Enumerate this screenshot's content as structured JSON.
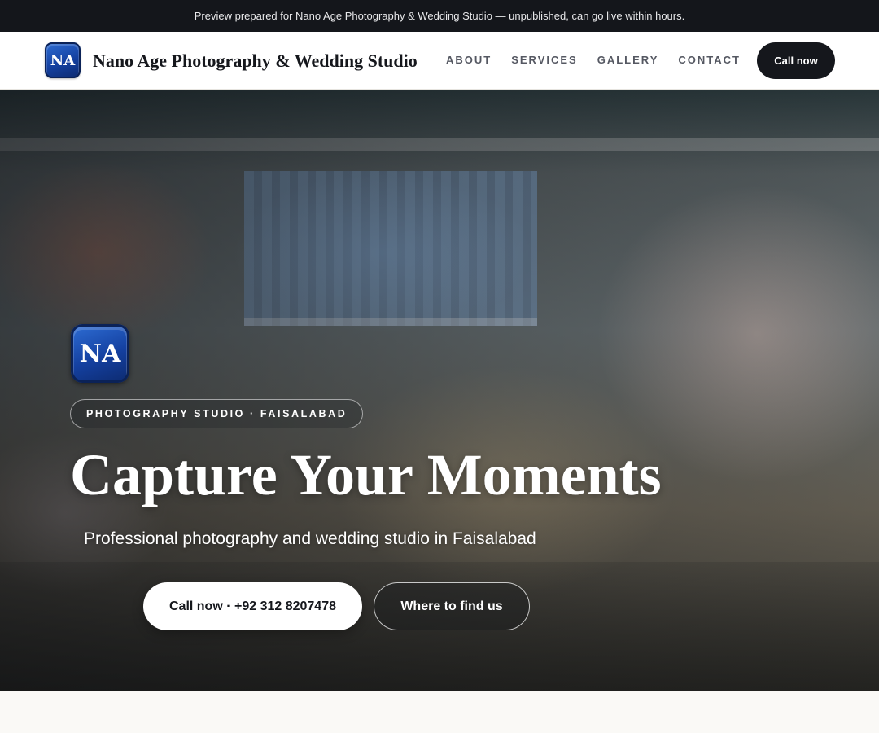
{
  "preview_bar": {
    "text": "Preview prepared for Nano Age Photography & Wedding Studio — unpublished, can go live within hours."
  },
  "nav": {
    "logo_text": "NA",
    "brand_name": "Nano Age Photography & Wedding Studio",
    "links": [
      {
        "label": "ABOUT"
      },
      {
        "label": "SERVICES"
      },
      {
        "label": "GALLERY"
      },
      {
        "label": "CONTACT"
      }
    ],
    "cta_label": "Call now"
  },
  "hero": {
    "logo_text": "NA",
    "badge": "PHOTOGRAPHY STUDIO · FAISALABAD",
    "title": "Capture Your Moments",
    "subtitle": "Professional photography and wedding studio in Faisalabad",
    "primary_button": "Call now · +92 312 8207478",
    "secondary_button": "Where to find us"
  },
  "colors": {
    "dark": "#15171c",
    "logo_blue": "#1440a0",
    "page_bg": "#faf9f6"
  }
}
